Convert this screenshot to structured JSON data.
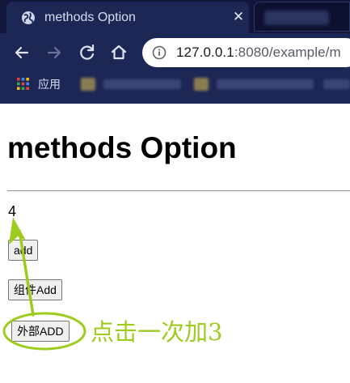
{
  "browser": {
    "tab_title": "methods Option",
    "tab_close_glyph": "✕",
    "url_host": "127.0.0.1",
    "url_rest": ":8080/example/m",
    "bookmarks_apps_label": "应用"
  },
  "page": {
    "title": "methods Option",
    "count": "4",
    "buttons": {
      "add_label": "add",
      "component_add_label": "组件Add",
      "external_add_label": "外部ADD"
    }
  },
  "annotation": {
    "text": "点击一次加3",
    "color": "#9ccc1e"
  },
  "colors": {
    "chrome_bg": "#1d2755",
    "tabstrip_bg": "#11173a",
    "annotation": "#9ccc1e"
  },
  "icons": {
    "favicon": "globe-icon",
    "close": "close-icon",
    "back": "arrow-left-icon",
    "forward": "arrow-right-icon",
    "reload": "reload-icon",
    "home": "home-icon",
    "site_info": "info-icon",
    "apps": "apps-grid-icon"
  }
}
